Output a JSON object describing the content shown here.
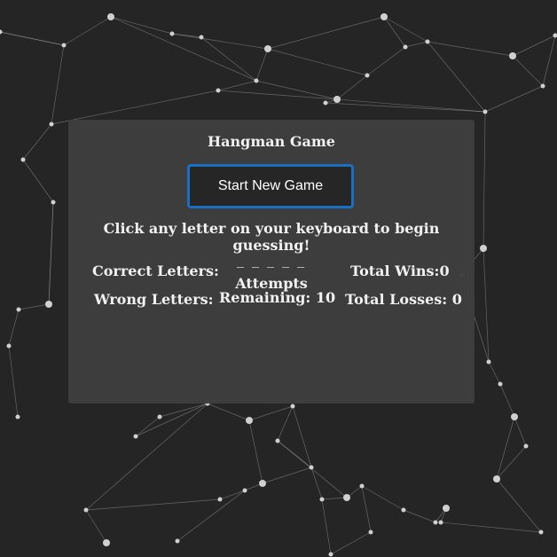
{
  "game": {
    "title": "Hangman Game",
    "start_button_label": "Start New Game",
    "instructions": "Click any letter on your keyboard to begin guessing!",
    "correct_letters_label": "Correct Letters:",
    "wrong_letters_label": "Wrong Letters:",
    "word_blanks": "_ _ _ _ _",
    "attempts_label_line1": "Attempts",
    "attempts_label_line2": "Remaining: 10",
    "total_wins_label": "Total Wins:0",
    "total_losses_label": "Total Losses: 0"
  },
  "colors": {
    "background": "#252525",
    "panel": "#3e3e3e",
    "button_bg": "#262626",
    "button_border": "#1a6fc0",
    "text": "#f1f1f1",
    "network_lines": "#9a9a9a"
  }
}
